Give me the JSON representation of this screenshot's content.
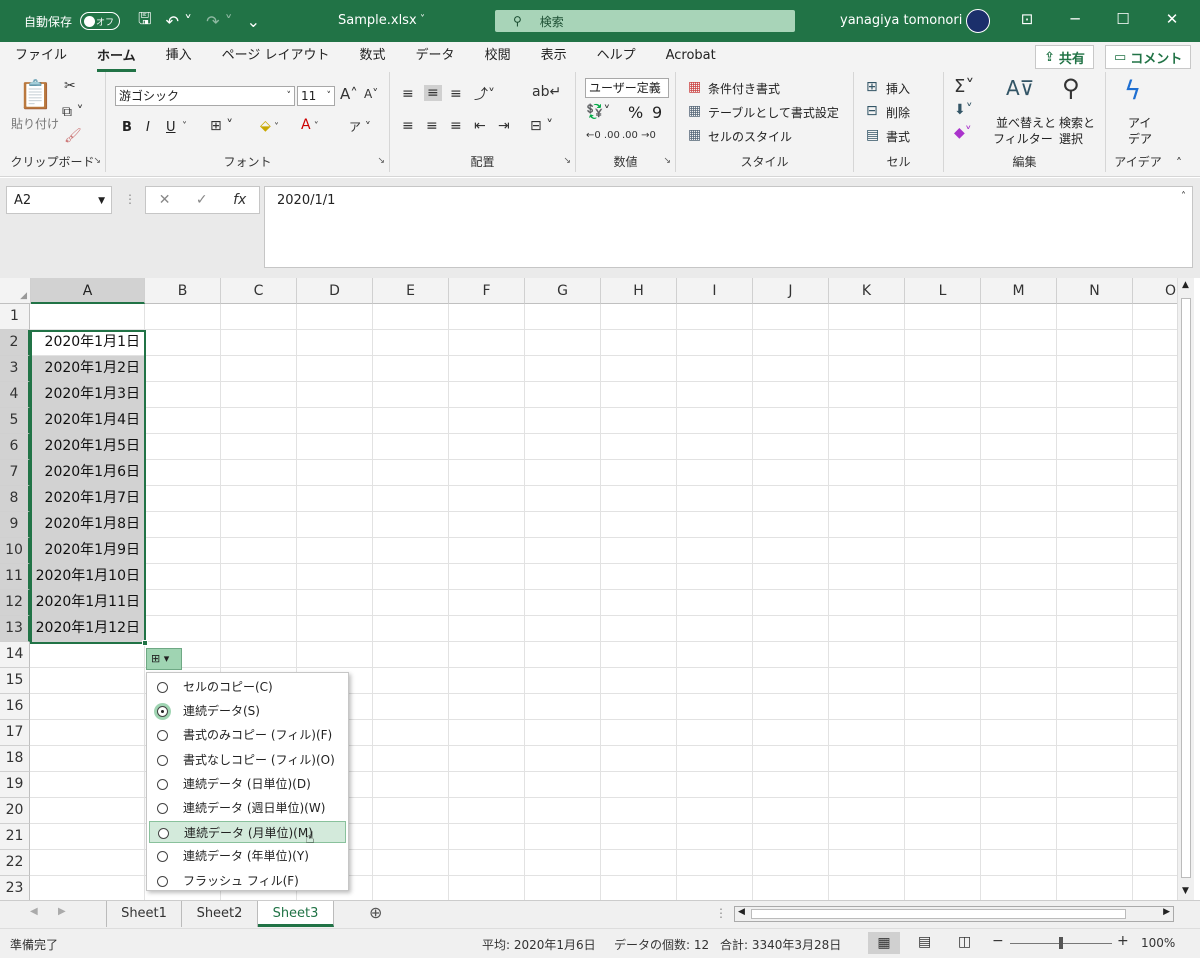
{
  "titlebar": {
    "autosave_label": "自動保存",
    "autosave_state": "オフ",
    "filename": "Sample.xlsx",
    "search_placeholder": "検索",
    "user_name": "yanagiya tomonori"
  },
  "tabs": [
    "ファイル",
    "ホーム",
    "挿入",
    "ページ レイアウト",
    "数式",
    "データ",
    "校閲",
    "表示",
    "ヘルプ",
    "Acrobat"
  ],
  "active_tab": "ホーム",
  "share_label": "共有",
  "comment_label": "コメント",
  "ribbon": {
    "clipboard": {
      "paste": "貼り付け",
      "label": "クリップボード"
    },
    "font": {
      "name": "游ゴシック",
      "size": "11",
      "label": "フォント",
      "bold": "B",
      "italic": "I",
      "underline": "U"
    },
    "alignment": {
      "label": "配置"
    },
    "number": {
      "format": "ユーザー定義",
      "percent": "%",
      "label": "数値"
    },
    "styles": {
      "cond": "条件付き書式",
      "table": "テーブルとして書式設定",
      "cell": "セルのスタイル",
      "label": "スタイル"
    },
    "cells": {
      "insert": "挿入",
      "delete": "削除",
      "format": "書式",
      "label": "セル"
    },
    "editing": {
      "sort1": "並べ替えと",
      "sort2": "フィルター",
      "find1": "検索と",
      "find2": "選択",
      "label": "編集"
    },
    "ideas": {
      "l1": "アイ",
      "l2": "デア",
      "label": "アイデア"
    }
  },
  "formula_bar": {
    "name_box": "A2",
    "fx": "fx",
    "value": "2020/1/1"
  },
  "columns": [
    "A",
    "B",
    "C",
    "D",
    "E",
    "F",
    "G",
    "H",
    "I",
    "J",
    "K",
    "L",
    "M",
    "N",
    "O"
  ],
  "rows": [
    "1",
    "2",
    "3",
    "4",
    "5",
    "6",
    "7",
    "8",
    "9",
    "10",
    "11",
    "12",
    "13",
    "14",
    "15",
    "16",
    "17",
    "18",
    "19",
    "20",
    "21",
    "22",
    "23"
  ],
  "cells_a": [
    "",
    "2020年1月1日",
    "2020年1月2日",
    "2020年1月3日",
    "2020年1月4日",
    "2020年1月5日",
    "2020年1月6日",
    "2020年1月7日",
    "2020年1月8日",
    "2020年1月9日",
    "2020年1月10日",
    "2020年1月11日",
    "2020年1月12日"
  ],
  "autofill_menu": [
    {
      "label": "セルのコピー(C)",
      "selected": false
    },
    {
      "label": "連続データ(S)",
      "selected": true
    },
    {
      "label": "書式のみコピー (フィル)(F)",
      "selected": false
    },
    {
      "label": "書式なしコピー (フィル)(O)",
      "selected": false
    },
    {
      "label": "連続データ (日単位)(D)",
      "selected": false
    },
    {
      "label": "連続データ (週日単位)(W)",
      "selected": false
    },
    {
      "label": "連続データ (月単位)(M)",
      "selected": false,
      "hover": true
    },
    {
      "label": "連続データ (年単位)(Y)",
      "selected": false
    },
    {
      "label": "フラッシュ フィル(F)",
      "selected": false
    }
  ],
  "sheets": [
    "Sheet1",
    "Sheet2",
    "Sheet3"
  ],
  "active_sheet": "Sheet3",
  "status": {
    "ready": "準備完了",
    "average": "平均: 2020年1月6日",
    "count": "データの個数: 12",
    "sum": "合計: 3340年3月28日",
    "zoom": "100%"
  },
  "colors": {
    "accent": "#217346"
  }
}
